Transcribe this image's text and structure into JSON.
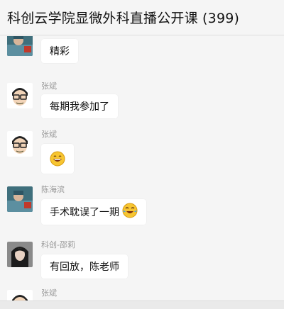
{
  "window": {
    "title": "科创云学院显微外科直播公开课 (399)"
  },
  "messages": [
    {
      "sender": "",
      "text": "精彩",
      "avatar": "photo-avatar-surgeon"
    },
    {
      "sender": "张斌",
      "text": "每期我参加了",
      "avatar": "cartoon-avatar-glasses"
    },
    {
      "sender": "张斌",
      "text": "",
      "emoji": "grinning-emoji",
      "avatar": "cartoon-avatar-glasses"
    },
    {
      "sender": "陈海滨",
      "text": "手术耽误了一期",
      "emoji": "crying-laughing-emoji",
      "avatar": "photo-avatar-surgeon"
    },
    {
      "sender": "科创-邵莉",
      "text": "有回放，陈老师",
      "avatar": "photo-avatar-woman"
    },
    {
      "sender": "张斌",
      "text": "",
      "avatar": "cartoon-avatar-glasses"
    }
  ]
}
